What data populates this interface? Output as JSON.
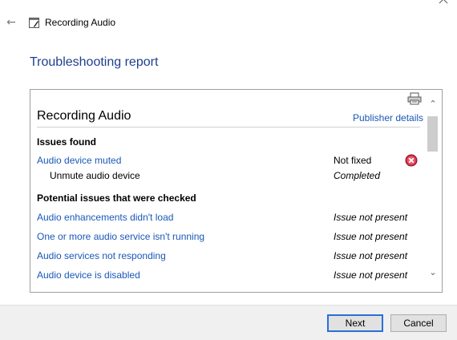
{
  "window": {
    "title": "Recording Audio"
  },
  "page": {
    "title": "Troubleshooting report"
  },
  "report": {
    "heading": "Recording Audio",
    "publisher_link": "Publisher details",
    "issues_found_label": "Issues found",
    "issues_found": [
      {
        "name": "Audio device muted",
        "status": "Not fixed",
        "status_icon": "error-x-icon"
      },
      {
        "name": "Unmute audio device",
        "status": "Completed"
      }
    ],
    "potential_label": "Potential issues that were checked",
    "potential_issues": [
      {
        "name": "Audio enhancements didn't load",
        "status": "Issue not present"
      },
      {
        "name": "One or more audio service isn't running",
        "status": "Issue not present"
      },
      {
        "name": "Audio services not responding",
        "status": "Issue not present"
      },
      {
        "name": "Audio device is disabled",
        "status": "Issue not present"
      }
    ]
  },
  "footer": {
    "next_label": "Next",
    "cancel_label": "Cancel"
  },
  "colors": {
    "link": "#1a57b8",
    "title": "#1e3f8e",
    "error": "#d9304a",
    "primary_border": "#2a6fd6"
  }
}
